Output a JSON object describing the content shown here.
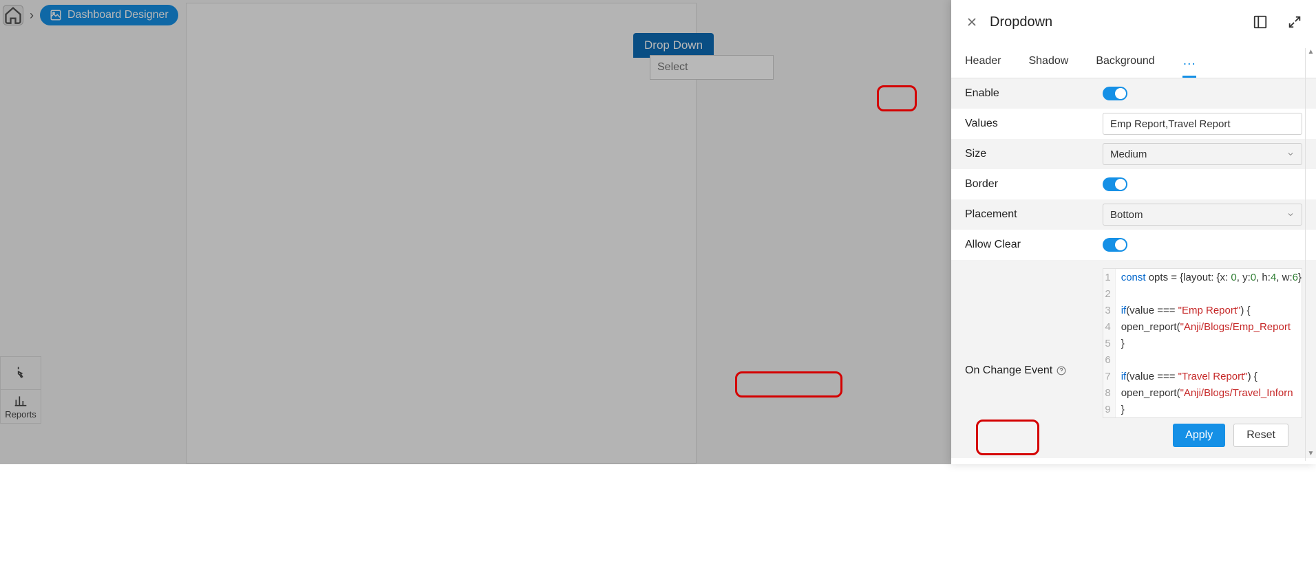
{
  "breadcrumb": {
    "designer": "Dashboard Designer"
  },
  "canvas": {
    "widget_title": "Drop Down",
    "select_placeholder": "Select"
  },
  "palette": {
    "click": "",
    "reports": "Reports"
  },
  "panel": {
    "title": "Dropdown",
    "tabs": {
      "header": "Header",
      "shadow": "Shadow",
      "background": "Background"
    },
    "props": {
      "enable_label": "Enable",
      "values_label": "Values",
      "values_value": "Emp Report,Travel Report",
      "size_label": "Size",
      "size_value": "Medium",
      "border_label": "Border",
      "placement_label": "Placement",
      "placement_value": "Bottom",
      "allowclear_label": "Allow Clear",
      "onchange_label": "On Change Event"
    },
    "code": {
      "l1_a": "const",
      "l1_b": " opts = {layout: {x: ",
      "l1_c": "0",
      "l1_d": ", y:",
      "l1_e": "0",
      "l1_f": ", h:",
      "l1_g": "4",
      "l1_h": ", w:",
      "l1_i": "6",
      "l1_j": "}",
      "l3_a": "if",
      "l3_b": "(value === ",
      "l3_c": "\"Emp Report\"",
      "l3_d": ") {",
      "l4_a": "open_report(",
      "l4_b": "\"Anji/Blogs/Emp_Report",
      "l5": "}",
      "l7_a": "if",
      "l7_b": "(value === ",
      "l7_c": "\"Travel Report\"",
      "l7_d": ") {",
      "l8_a": "open_report(",
      "l8_b": "\"Anji/Blogs/Travel_Inforn",
      "l9": "}"
    },
    "buttons": {
      "apply": "Apply",
      "reset": "Reset"
    }
  }
}
